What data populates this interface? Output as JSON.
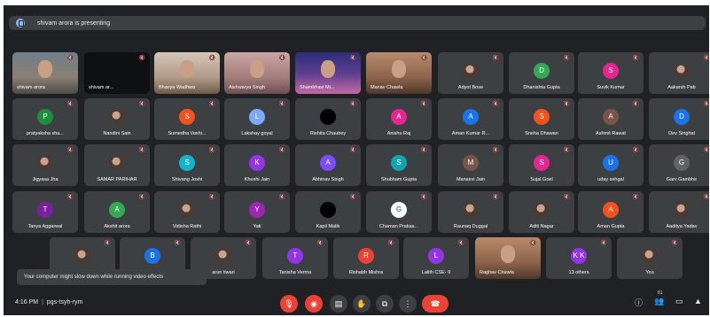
{
  "banner": {
    "text": "shivam arora is presenting"
  },
  "participants": {
    "row1": [
      "shivam arora",
      "shivam ar...",
      "Bhavya Wadhwa",
      "Aishwarya Singh",
      "Shambhavi Mi...",
      "Manav Chawla",
      "Adyot Bose",
      "Dhanishta Gupta",
      "Suvik Kumar",
      "Aakarsh Pab"
    ],
    "row2": [
      "pratyaksha sha...",
      "Nandini Sain",
      "Sumedha Vashi...",
      "Lakshay goyal",
      "Rishita Chaubey",
      "Anishu Raj",
      "Aman Kumar R...",
      "Sneha Dhawan",
      "Ashmit Rawat",
      "Dev Singhal"
    ],
    "row3": [
      "Jigyasa Jha",
      "SAMAR PARIHAR",
      "Shivang Joshi",
      "Khushi Jain",
      "Abhinav Singh",
      "Shubham Gupta",
      "Manasvi Jain",
      "Sujal Goel",
      "uday sehgal",
      "Garv Gambhir"
    ],
    "row4": [
      "Tanya Aggarwal",
      "Akshit arora",
      "Vidisha Rathi",
      "Yati",
      "Kapil Malik",
      "Chaman Prakas...",
      "Raunaq Duggal",
      "Aditi Nagar",
      "Aman Gupta",
      "Aaditya Yadav"
    ],
    "row5": [
      "",
      "",
      "arun tiwari",
      "Tanisha Verma",
      "Rishabh Mishra",
      "Lalith CSE- II",
      "Raghav Chawla",
      "13 others",
      "You"
    ]
  },
  "initials": {
    "row1": [
      "",
      "",
      "",
      "",
      "",
      "",
      "",
      "D",
      "S",
      ""
    ],
    "row2": [
      "P",
      "",
      "S",
      "L",
      "",
      "A",
      "A",
      "S",
      "A",
      "D"
    ],
    "row3": [
      "",
      "",
      "S",
      "K",
      "A",
      "S",
      "M",
      "S",
      "U",
      "G"
    ],
    "row4": [
      "T",
      "A",
      "",
      "Y",
      "",
      "G",
      "",
      "",
      "A",
      ""
    ],
    "row5": [
      "",
      "B",
      "",
      "T",
      "R",
      "L",
      "",
      "K K",
      ""
    ]
  },
  "colors": {
    "row1": [
      "",
      "",
      "",
      "",
      "",
      "",
      "",
      "#34a853",
      "#e52592",
      ""
    ],
    "row2": [
      "#1e8e3e",
      "",
      "#f4511e",
      "#7baaf7",
      "#000000",
      "#e52592",
      "#1a73e8",
      "#f4511e",
      "#795548",
      "#1a73e8"
    ],
    "row3": [
      "",
      "",
      "#12b5cb",
      "#9334e6",
      "#7c4dff",
      "#12a4af",
      "#795548",
      "#e52592",
      "#1a73e8",
      "#5f6368"
    ],
    "row4": [
      "#7b1fa2",
      "#34a853",
      "",
      "#9c27b0",
      "#000000",
      "#ffffff",
      "",
      "",
      "#f4511e",
      ""
    ],
    "row5": [
      "",
      "#1a73e8",
      "",
      "#9334e6",
      "#ea4335",
      "#9334e6",
      "",
      "#9334e6",
      ""
    ]
  },
  "toast": {
    "text": "Your computer might slow down while running video effects"
  },
  "bottom_bar": {
    "time": "4:16 PM",
    "meeting_code": "pgs-tsyh-rym",
    "mic_icon": "mic-off-icon",
    "cam_icon": "camera-off-icon",
    "captions_icon": "captions-icon",
    "hand_icon": "raise-hand-icon",
    "present_icon": "present-icon",
    "more_icon": "more-icon",
    "leave_icon": "end-call-icon",
    "people_count": "61"
  }
}
